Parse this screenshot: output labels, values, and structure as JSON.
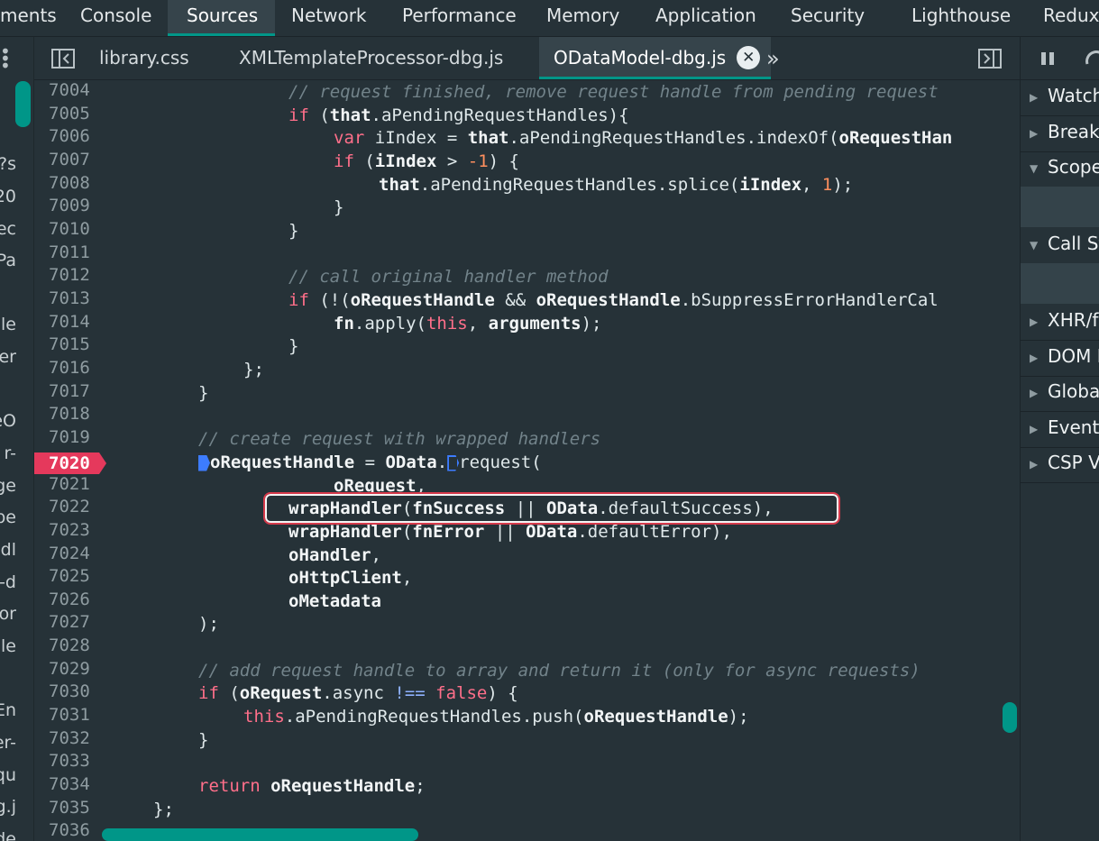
{
  "devtools_tabs": [
    {
      "label": "ments"
    },
    {
      "label": "Console"
    },
    {
      "label": "Sources"
    },
    {
      "label": "Network"
    },
    {
      "label": "Performance"
    },
    {
      "label": "Memory"
    },
    {
      "label": "Application"
    },
    {
      "label": "Security"
    },
    {
      "label": "Lighthouse"
    },
    {
      "label": "Redux"
    }
  ],
  "file_tabs": [
    {
      "label": "library.css"
    },
    {
      "label": "XMLTemplateProcessor-dbg.js"
    },
    {
      "label": "ODataModel-dbg.js"
    }
  ],
  "left_fragments": [
    "?s",
    "20",
    "ec",
    "Pa",
    "lle",
    "er",
    "eO",
    "r-",
    "ge",
    "pe",
    "-dl",
    "e-d",
    "or",
    "ole",
    "En",
    "er-",
    "qu",
    "g.j",
    "de"
  ],
  "line_numbers": [
    "7004",
    "7005",
    "7006",
    "7007",
    "7008",
    "7009",
    "7010",
    "7011",
    "7012",
    "7013",
    "7014",
    "7015",
    "7016",
    "7017",
    "7018",
    "7019",
    "7020",
    "7021",
    "7022",
    "7023",
    "7024",
    "7025",
    "7026",
    "7027",
    "7028",
    "7029",
    "7030",
    "7031",
    "7032",
    "7033",
    "7034",
    "7035",
    "7036"
  ],
  "breakpoint_line": "7020",
  "code": {
    "l7004": "// request finished, remove request handle from pending request",
    "l7005": [
      "if",
      " (",
      "that",
      ".aPendingRequestHandles){"
    ],
    "l7006": [
      "var",
      " iIndex = ",
      "that",
      ".aPendingRequestHandles.indexOf(",
      "oRequestHan"
    ],
    "l7007": [
      "if",
      " (",
      "iIndex",
      " > ",
      "-1",
      ") {"
    ],
    "l7008": [
      "that",
      ".aPendingRequestHandles.splice(",
      "iIndex",
      ", ",
      "1",
      ");"
    ],
    "l7009": "}",
    "l7010": "}",
    "l7012": "// call original handler method",
    "l7013": [
      "if",
      " (!(",
      "oRequestHandle",
      " && ",
      "oRequestHandle",
      ".bSuppressErrorHandlerCal"
    ],
    "l7014": [
      "fn",
      ".apply(",
      "this",
      ", ",
      "arguments",
      ");"
    ],
    "l7015": "}",
    "l7016": "};",
    "l7017": "}",
    "l7019": "// create request with wrapped handlers",
    "l7020": [
      "oRequestHandle",
      " = ",
      "OData",
      ".",
      "request("
    ],
    "l7021": [
      "oRequest",
      ","
    ],
    "l7022": [
      "wrapHandler",
      "(",
      "fnSuccess",
      " || ",
      "OData",
      ".defaultSuccess),"
    ],
    "l7023": [
      "wrapHandler",
      "(",
      "fnError",
      " || ",
      "OData",
      ".defaultError),"
    ],
    "l7024": [
      "oHandler",
      ","
    ],
    "l7025": [
      "oHttpClient",
      ","
    ],
    "l7026": [
      "oMetadata"
    ],
    "l7027": ");",
    "l7029": "// add request handle to array and return it (only for async requests)",
    "l7030": [
      "if",
      " (",
      "oRequest",
      ".async ",
      "!==",
      " ",
      "false",
      ") {"
    ],
    "l7031": [
      "this",
      ".aPendingRequestHandles.push(",
      "oRequestHandle",
      ");"
    ],
    "l7032": "}",
    "l7034": [
      "return",
      " ",
      "oRequestHandle",
      ";"
    ],
    "l7035": "};"
  },
  "right_panel": {
    "sections": [
      {
        "label": "Watch"
      },
      {
        "label": "Breakp"
      },
      {
        "label": "Scope"
      },
      {
        "label": "Call St"
      },
      {
        "label": "XHR/f"
      },
      {
        "label": "DOM B"
      },
      {
        "label": "Global"
      },
      {
        "label": "Event"
      },
      {
        "label": "CSP V"
      }
    ]
  }
}
